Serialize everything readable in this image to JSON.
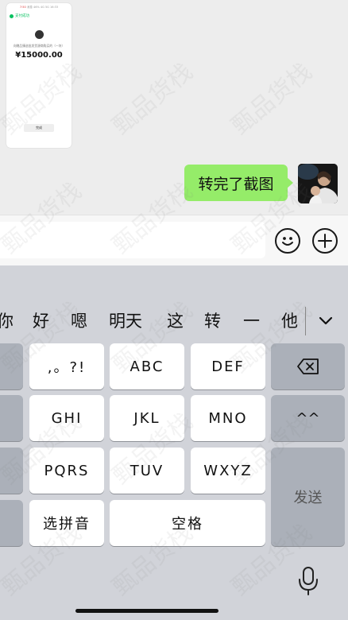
{
  "chat": {
    "screenshot_thumb": {
      "status_time": "7:50",
      "status_right": "46% 4G 5G 16:33",
      "status_flag": "消息",
      "pay_label": "支付成功",
      "desc": "向赠品臻选批发货源商购买的（一块）",
      "amount": "¥15000.00",
      "done_label": "完成"
    },
    "sent_message": "转完了截图"
  },
  "input_bar": {
    "placeholder": "",
    "emoji_icon": "emoji-face-icon",
    "plus_icon": "plus-circle-icon"
  },
  "keyboard": {
    "candidates": [
      "你",
      "好",
      "嗯",
      "明天",
      "这",
      "转",
      "一",
      "他"
    ],
    "keys": {
      "punct": ",。?!",
      "abc": "ABC",
      "def": "DEF",
      "ghi": "GHI",
      "jkl": "JKL",
      "mno": "MNO",
      "pqrs": "PQRS",
      "tuv": "TUV",
      "wxyz": "WXYZ",
      "pinyin": "选拼音",
      "space": "空格",
      "emoticon": "^^",
      "send": "发送"
    }
  },
  "watermark": "甄品货栈",
  "colors": {
    "bubble": "#95ec69",
    "chat_bg": "#ededed",
    "keyboard_bg": "#d1d3d9",
    "key_white": "#ffffff",
    "key_gray": "#abb0b9"
  }
}
